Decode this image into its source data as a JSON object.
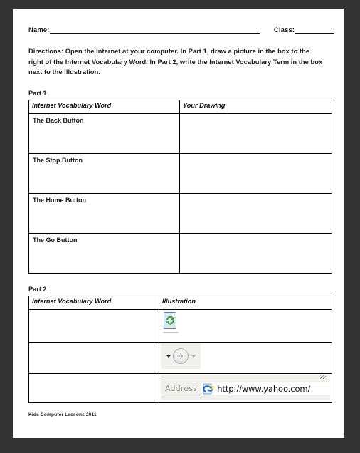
{
  "worksheet": {
    "name_label": "Name:",
    "class_label": "Class:",
    "directions": "Directions: Open the Internet at your computer. In Part 1, draw a picture in the box to the right of the Internet Vocabulary Word. In Part 2, write the Internet Vocabulary Term in the box next to the illustration.",
    "footer": "Kids Computer Lessons 2011"
  },
  "part1": {
    "label": "Part 1",
    "headers": [
      "Internet Vocabulary Word",
      "Your Drawing"
    ],
    "rows": [
      {
        "word": "The Back Button",
        "drawing": ""
      },
      {
        "word": "The Stop Button",
        "drawing": ""
      },
      {
        "word": "The Home Button",
        "drawing": ""
      },
      {
        "word": "The Go Button",
        "drawing": ""
      }
    ]
  },
  "part2": {
    "label": "Part 2",
    "headers": [
      "Internet Vocabulary Word",
      "Illustration"
    ],
    "rows": [
      {
        "word": "",
        "illustration": "refresh-icon"
      },
      {
        "word": "",
        "illustration": "go-button-icon"
      },
      {
        "word": "",
        "illustration": "address-bar"
      }
    ],
    "address_bar": {
      "label": "Address",
      "url": "http://www.yahoo.com/",
      "icon": "internet-explorer-icon"
    }
  },
  "colors": {
    "page": "#ffffff",
    "backdrop": "#333333",
    "ink": "#1a1a1a",
    "refresh_green": "#3a9e3a",
    "ie_blue": "#1e6fc4"
  }
}
